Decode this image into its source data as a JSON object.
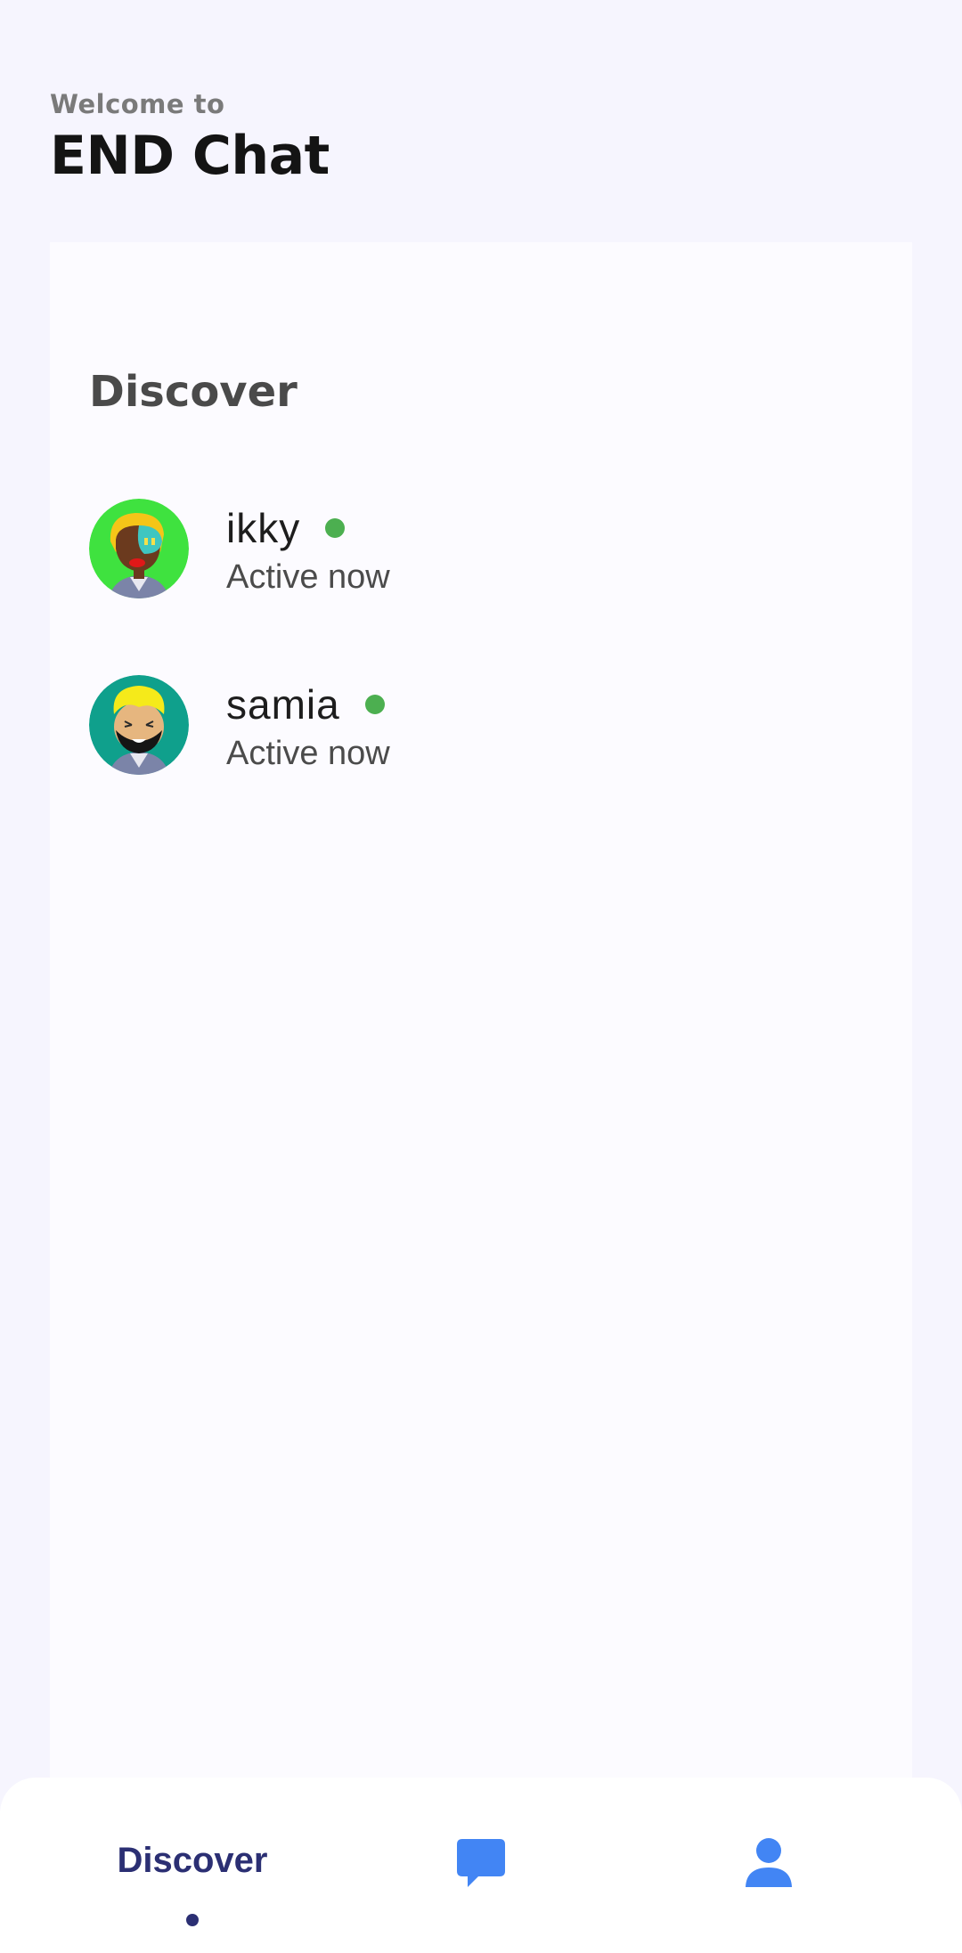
{
  "header": {
    "subtitle": "Welcome to",
    "title": "END Chat"
  },
  "discover": {
    "title": "Discover",
    "users": [
      {
        "name": "ikky",
        "status": "Active now",
        "avatar_icon": "avatar-ikky-icon",
        "online": true
      },
      {
        "name": "samia",
        "status": "Active now",
        "avatar_icon": "avatar-samia-icon",
        "online": true
      }
    ]
  },
  "bottom_nav": {
    "items": [
      {
        "label": "Discover",
        "icon": null,
        "active": true
      },
      {
        "label": "",
        "icon": "chat-bubble-icon",
        "active": false
      },
      {
        "label": "",
        "icon": "person-icon",
        "active": false
      }
    ]
  },
  "colors": {
    "background": "#F6F5FE",
    "panel": "#FCFBFF",
    "online": "#4CAF50",
    "nav_active_text": "#2B2F73",
    "nav_icon": "#4285F4"
  }
}
